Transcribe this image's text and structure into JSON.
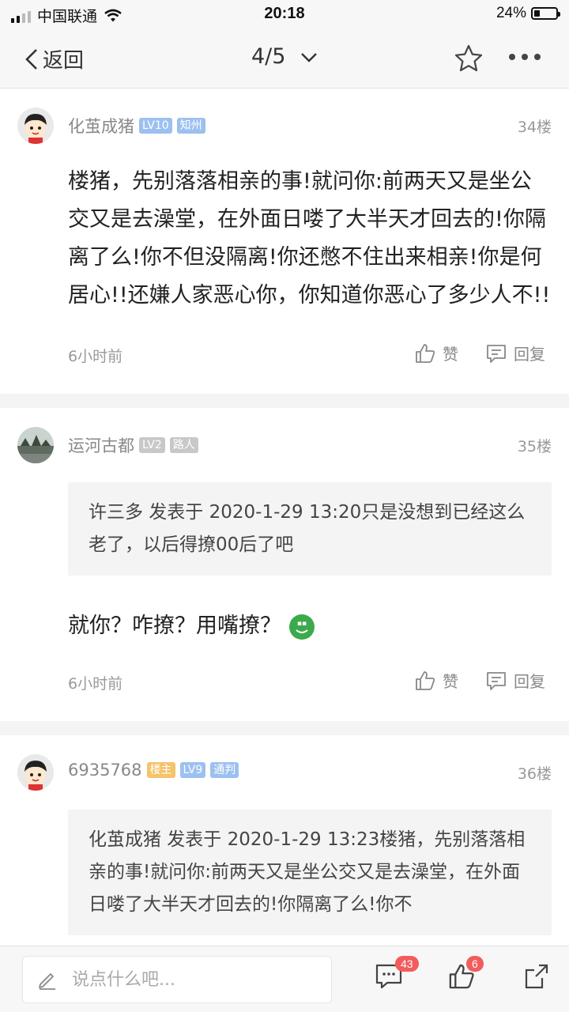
{
  "status": {
    "carrier": "中国联通",
    "time": "20:18",
    "battery": "24%"
  },
  "nav": {
    "back_label": "返回",
    "page_indicator": "4/5"
  },
  "posts": [
    {
      "username": "化茧成猪",
      "badges": [
        "LV10",
        "知州"
      ],
      "floor": "34楼",
      "content": "楼猪，先别落落相亲的事!就问你:前两天又是坐公交又是去澡堂，在外面日喽了大半天才回去的!你隔离了么!你不但没隔离!你还憋不住出来相亲!你是何居心!!还嫌人家恶心你，你知道你恶心了多少人不!!",
      "time": "6小时前",
      "like": "赞",
      "reply": "回复"
    },
    {
      "username": "运河古都",
      "badges": [
        "LV2",
        "路人"
      ],
      "floor": "35楼",
      "quote": "许三多 发表于 2020-1-29 13:20只是没想到已经这么老了，以后得撩00后了吧",
      "content": "就你？咋撩？用嘴撩？",
      "time": "6小时前",
      "like": "赞",
      "reply": "回复"
    },
    {
      "username": "6935768",
      "badges": [
        "楼主",
        "LV9",
        "通判"
      ],
      "floor": "36楼",
      "quote": "化茧成猪 发表于 2020-1-29 13:23楼猪，先别落落相亲的事!就问你:前两天又是坐公交又是去澡堂，在外面日喽了大半天才回去的!你隔离了么!你不"
    }
  ],
  "bottom": {
    "placeholder": "说点什么吧...",
    "comment_count": "43",
    "like_count": "6"
  },
  "colors": {
    "badge_blue": "#9cc0f0",
    "badge_gray": "#c8c8c8",
    "badge_orange": "#f5c36b",
    "count_red": "#f25c5c"
  },
  "icons": [
    "back-chevron-icon",
    "dropdown-chevron-icon",
    "star-icon",
    "more-icon",
    "like-icon",
    "reply-icon",
    "edit-icon",
    "comment-icon",
    "share-icon"
  ]
}
